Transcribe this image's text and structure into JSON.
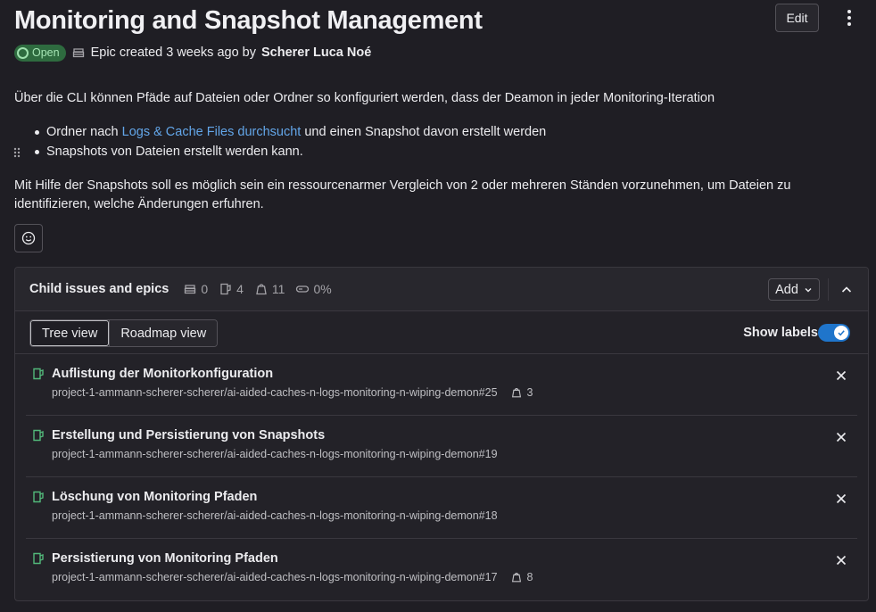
{
  "header": {
    "title": "Monitoring and Snapshot Management",
    "edit_label": "Edit"
  },
  "meta": {
    "status": "Open",
    "created_text": "Epic created 3 weeks ago by",
    "author": "Scherer Luca Noé"
  },
  "description": {
    "paragraph1": "Über die CLI können Pfäde auf Dateien oder Ordner so konfiguriert werden, dass der Deamon in jeder Monitoring-Iteration",
    "bullet1_before": "Ordner nach ",
    "bullet1_link": "Logs & Cache Files durchsucht",
    "bullet1_after": " und einen Snapshot davon erstellt werden",
    "bullet2": "Snapshots von Dateien erstellt werden kann.",
    "paragraph2": "Mit Hilfe der Snapshots soll es möglich sein ein ressourcenarmer Vergleich von 2 oder mehreren Ständen vorzunehmen, um Dateien zu identifizieren, welche Änderungen erfuhren."
  },
  "child_issues": {
    "title": "Child issues and epics",
    "counts": {
      "epics": "0",
      "issues": "4",
      "weight": "11",
      "progress": "0%"
    },
    "add_label": "Add",
    "view_tree": "Tree view",
    "view_roadmap": "Roadmap view",
    "show_labels": "Show labels",
    "show_labels_on": true,
    "items": [
      {
        "title": "Auflistung der Monitorkonfiguration",
        "ref": "project-1-ammann-scherer-scherer/ai-aided-caches-n-logs-monitoring-n-wiping-demon#25",
        "weight": "3"
      },
      {
        "title": "Erstellung und Persistierung von Snapshots",
        "ref": "project-1-ammann-scherer-scherer/ai-aided-caches-n-logs-monitoring-n-wiping-demon#19",
        "weight": ""
      },
      {
        "title": "Löschung von Monitoring Pfaden",
        "ref": "project-1-ammann-scherer-scherer/ai-aided-caches-n-logs-monitoring-n-wiping-demon#18",
        "weight": ""
      },
      {
        "title": "Persistierung von Monitoring Pfaden",
        "ref": "project-1-ammann-scherer-scherer/ai-aided-caches-n-logs-monitoring-n-wiping-demon#17",
        "weight": "8"
      }
    ]
  },
  "colors": {
    "background": "#1f1e24",
    "link": "#63a6e9",
    "open_badge_bg": "#2e6b3f",
    "issue_icon": "#52b87a",
    "toggle_on": "#1f75cb"
  },
  "icons": [
    "kebab-icon",
    "epic-icon",
    "smiley-icon",
    "issue-icon",
    "weight-icon",
    "progress-icon",
    "chevron-down-icon",
    "chevron-up-icon",
    "check-icon",
    "close-icon",
    "drag-handle-icon"
  ]
}
